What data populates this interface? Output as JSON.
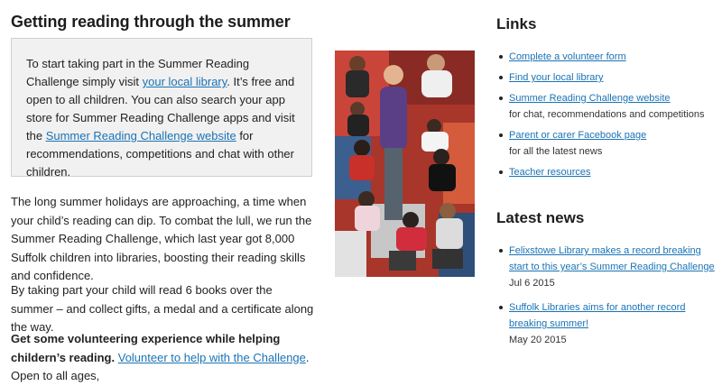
{
  "main": {
    "title": "Getting reading through the summer",
    "callout": {
      "text_1": "To start taking part in the Summer Reading Challenge simply visit ",
      "link_1": "your local library",
      "text_2": ". It’s free and open to all children. You can also search your app store for Summer Reading Challenge apps and visit the ",
      "link_2": "Summer Reading Challenge website",
      "text_3": " for recommendations, competitions and chat with other children."
    },
    "paragraph_1": "The long summer holidays are approaching, a time when your child’s reading can dip. To combat the lull, we run the Summer Reading Challenge, which last year got 8,000 Suffolk children into libraries, boosting their reading skills and confidence.",
    "paragraph_2": "By taking part your child will read 6 books over the summer – and collect gifts, a medal and a certificate along the way.",
    "paragraph_3": {
      "bold": "Get some volunteering experience while helping childern’s reading.",
      "link": "Volunteer to help with the Challenge",
      "text": ". Open to all ages,"
    }
  },
  "sidebar": {
    "links_heading": "Links",
    "links": [
      {
        "label": "Complete a volunteer form",
        "note": ""
      },
      {
        "label": "Find your local library",
        "note": ""
      },
      {
        "label": "Summer Reading Challenge website",
        "note": "for chat, recommendations and competitions"
      },
      {
        "label": "Parent or carer Facebook page",
        "note": "for all the latest news"
      },
      {
        "label": "Teacher resources",
        "note": ""
      }
    ],
    "news_heading": "Latest news",
    "news": [
      {
        "title": "Felixstowe Library makes a record breaking start to this year’s Summer Reading Challenge",
        "date": "Jul 6 2015"
      },
      {
        "title": "Suffolk Libraries aims for another record breaking summer!",
        "date": "May 20 2015"
      }
    ]
  },
  "colors": {
    "link": "#1a73b5",
    "callout_bg": "#f1f1f1",
    "callout_border": "#cfcfcf"
  }
}
